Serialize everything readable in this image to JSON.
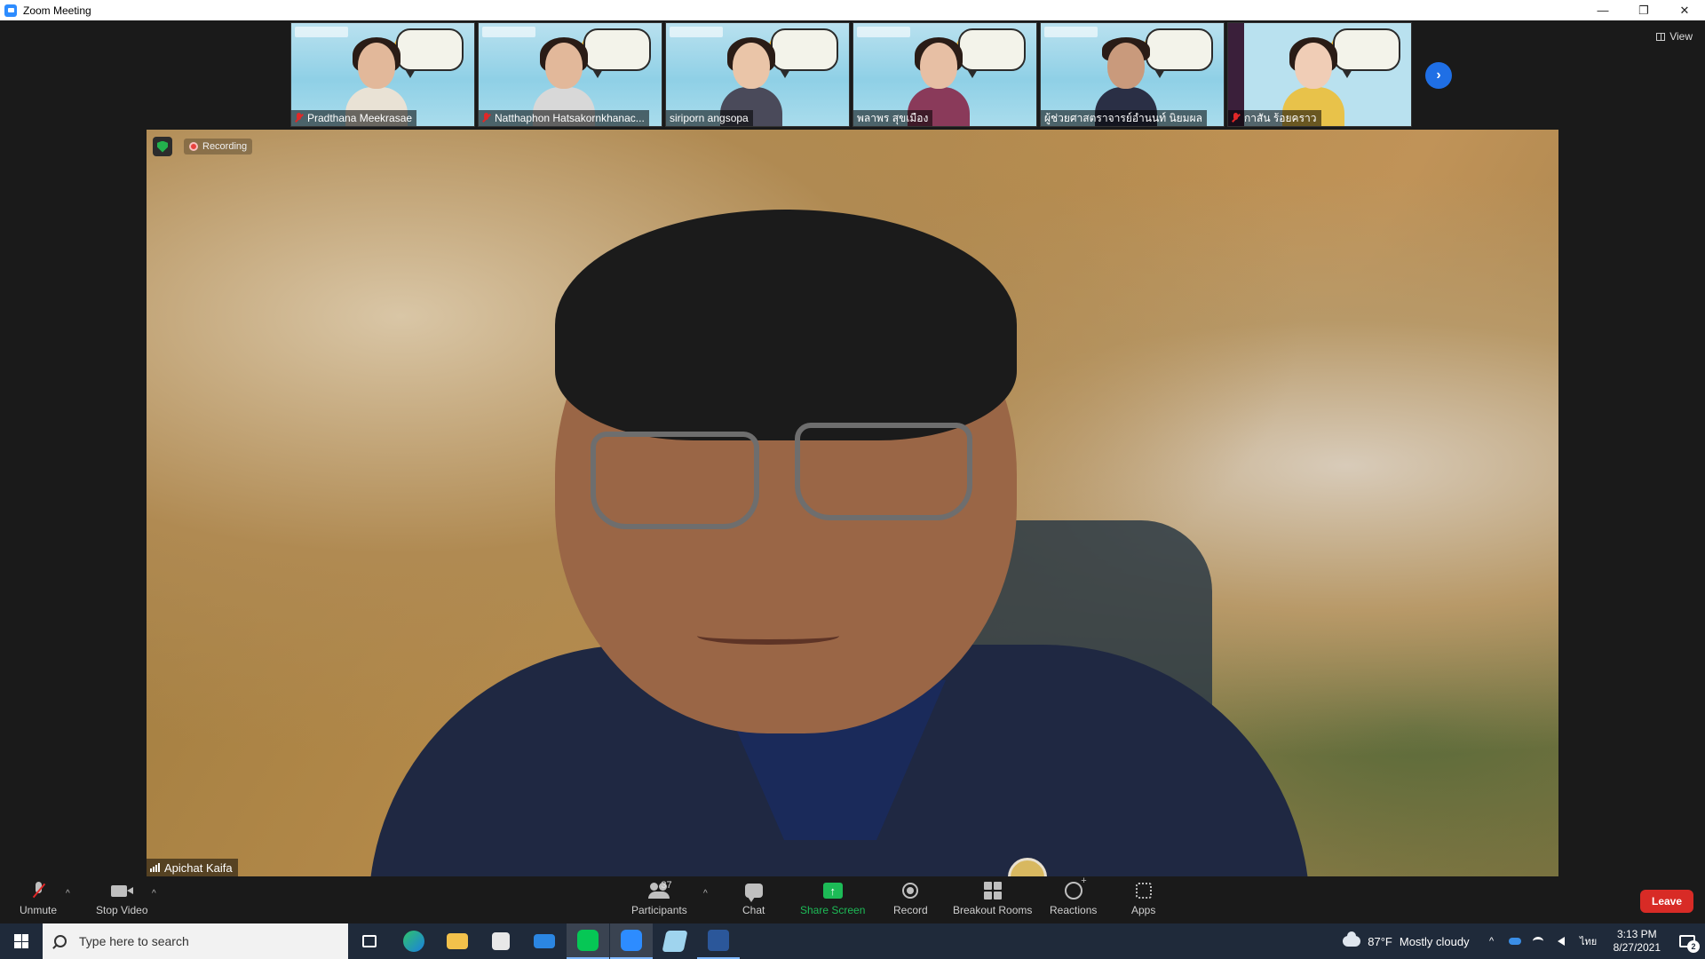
{
  "window": {
    "title": "Zoom Meeting",
    "minimize": "—",
    "restore": "❐",
    "close": "✕"
  },
  "gallery": {
    "participants": [
      {
        "name": "Pradthana Meekrasae",
        "muted": true
      },
      {
        "name": "Natthaphon Hatsakornkhanac...",
        "muted": true
      },
      {
        "name": "siriporn angsopa",
        "muted": false
      },
      {
        "name": "พลาพร สุขเมือง",
        "muted": false
      },
      {
        "name": "ผู้ช่วยศาสตราจารย์อำนนท์ นิยมผล",
        "muted": false
      },
      {
        "name": "กาสัน ร้อยคราว",
        "muted": true
      }
    ],
    "next_label": "›",
    "view_label": "View"
  },
  "main_video": {
    "recording_label": "Recording",
    "speaker_name": "Apichat Kaifa"
  },
  "toolbar": {
    "unmute": "Unmute",
    "stop_video": "Stop Video",
    "participants": "Participants",
    "participant_count": "37",
    "chat": "Chat",
    "share_screen": "Share Screen",
    "record": "Record",
    "breakout_rooms": "Breakout Rooms",
    "reactions": "Reactions",
    "apps": "Apps",
    "leave": "Leave",
    "caret": "^",
    "share_arrow": "↑"
  },
  "taskbar": {
    "search_placeholder": "Type here to search",
    "weather_temp": "87°F",
    "weather_desc": "Mostly cloudy",
    "time": "3:13 PM",
    "date": "8/27/2021",
    "language": "ไทย",
    "notifications": "2",
    "tray_up": "^",
    "app_icons": [
      "task-view",
      "edge",
      "file-explorer",
      "store",
      "mail",
      "line",
      "zoom",
      "notes",
      "word"
    ]
  },
  "colors": {
    "share_green": "#1dbb57",
    "leave_red": "#d82b26",
    "zoom_blue": "#2d8cff",
    "muted_red": "#e02828"
  }
}
